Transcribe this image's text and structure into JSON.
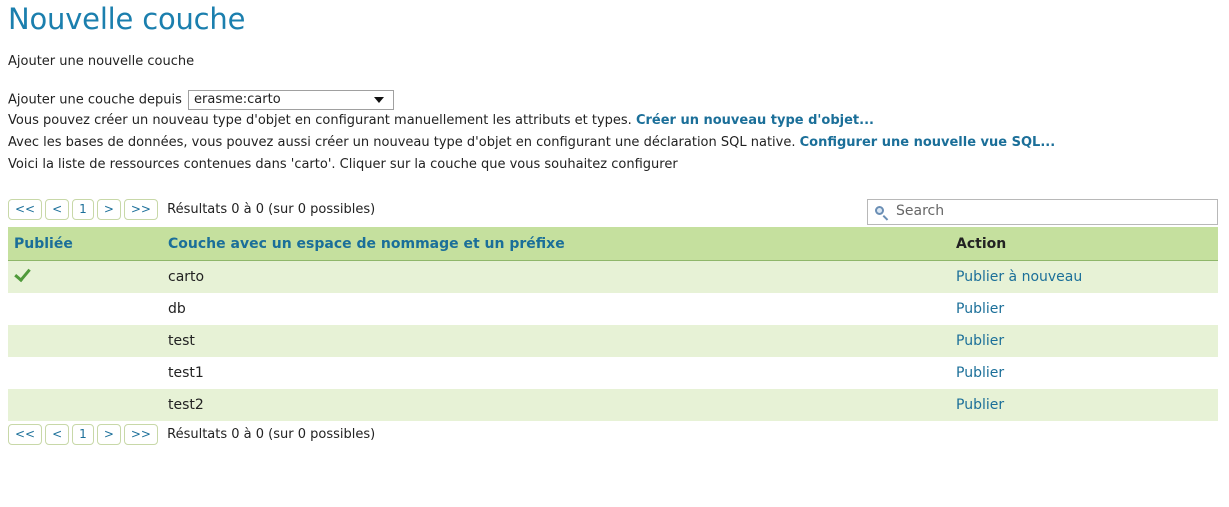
{
  "page": {
    "title": "Nouvelle couche",
    "subtitle": "Ajouter une nouvelle couche"
  },
  "source": {
    "label": "Ajouter une couche depuis",
    "selected": "erasme:carto"
  },
  "info": {
    "line1_text": "Vous pouvez créer un nouveau type d'objet en configurant manuellement les attributs et types.",
    "line1_link": "Créer un nouveau type d'objet...",
    "line2_text": "Avec les bases de données, vous pouvez aussi créer un nouveau type d'objet en configurant une déclaration SQL native.",
    "line2_link": "Configurer une nouvelle vue SQL...",
    "line3_text": "Voici la liste de ressources contenues dans 'carto'. Cliquer sur la couche que vous souhaitez configurer"
  },
  "pager": {
    "first": "<<",
    "prev": "<",
    "page": "1",
    "next": ">",
    "last": ">>",
    "results": "Résultats 0 à 0 (sur 0 possibles)"
  },
  "search": {
    "placeholder": "Search",
    "icon": "search-icon"
  },
  "table": {
    "headers": {
      "published": "Publiée",
      "layer": "Couche avec un espace de nommage et un préfixe",
      "action": "Action"
    },
    "rows": [
      {
        "published": true,
        "name": "carto",
        "action": "Publier à nouveau"
      },
      {
        "published": false,
        "name": "db",
        "action": "Publier"
      },
      {
        "published": false,
        "name": "test",
        "action": "Publier"
      },
      {
        "published": false,
        "name": "test1",
        "action": "Publier"
      },
      {
        "published": false,
        "name": "test2",
        "action": "Publier"
      }
    ]
  },
  "colors": {
    "title": "#1b7fae",
    "link": "#1b6f99",
    "header_bg": "#c5e09e",
    "row_alt_bg": "#e7f2d6",
    "check": "#4f9a3a"
  }
}
